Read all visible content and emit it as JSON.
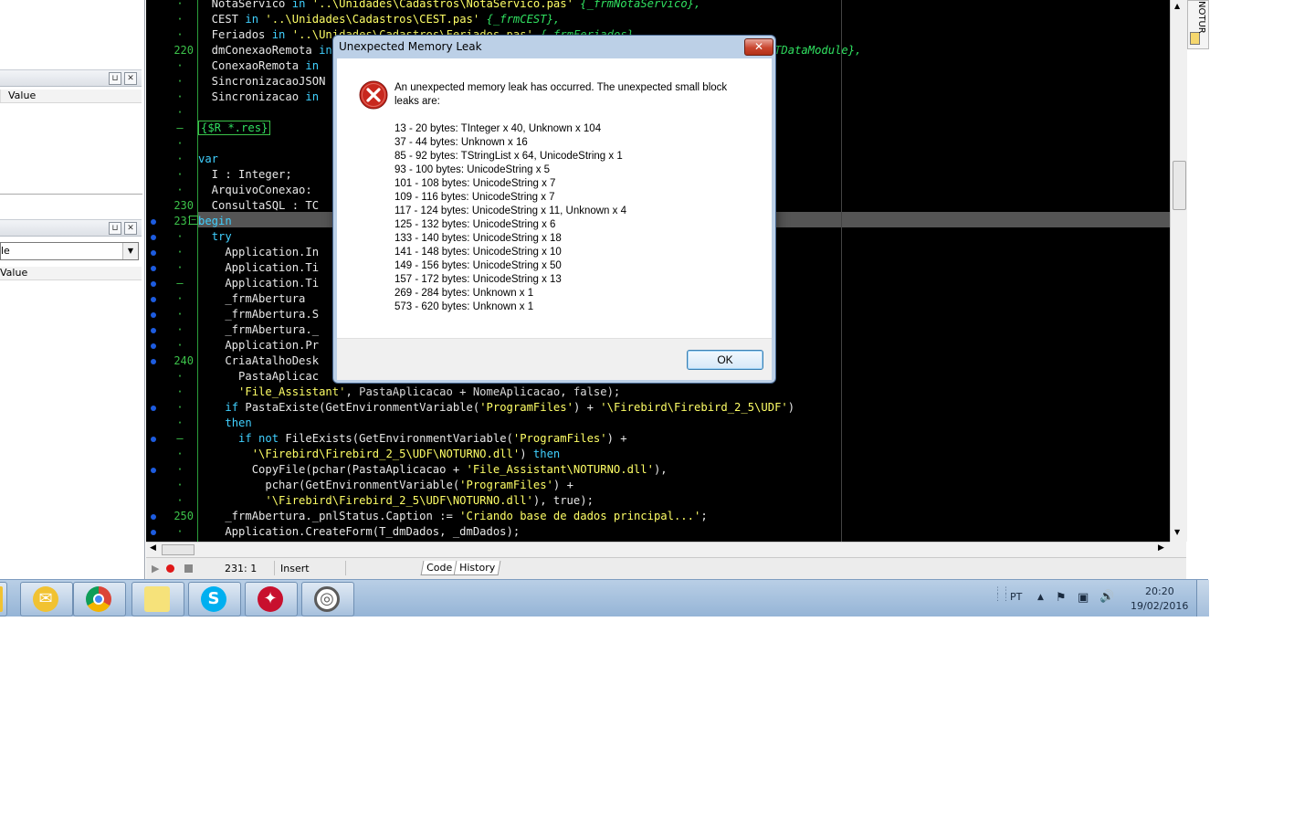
{
  "left_panel": {
    "panel1_header": "Value",
    "panel2_combo": "le",
    "panel2_header": "Value"
  },
  "editor": {
    "code_lines": [
      {
        "gutter": "·",
        "num": "",
        "bp": false,
        "html": "  NotaServico <span class=\"kw\">in</span> <span class=\"str\">'..\\Unidades\\Cadastros\\NotaServico.pas'</span> <span class=\"cmt\">{_frmNotaServico},</span>"
      },
      {
        "gutter": "·",
        "num": "",
        "bp": false,
        "html": "  CEST <span class=\"kw\">in</span> <span class=\"str\">'..\\Unidades\\Cadastros\\CEST.pas'</span> <span class=\"cmt\">{_frmCEST},</span>"
      },
      {
        "gutter": "·",
        "num": "",
        "bp": false,
        "html": "  Feriados <span class=\"kw\">in</span> <span class=\"str\">'..\\Unidades\\Cadastros\\Feriados.pas'</span> <span class=\"cmt\">{_frmFeriados},</span>"
      },
      {
        "gutter": "",
        "num": "220",
        "bp": false,
        "html": "  dmConexaoRemota <span class=\"kw\">in</span> <span class=\"str\">'..\\Unidades\\DataModules\\dmConexaoRemota.pas'</span> <span class=\"cmt\">{_dmConexaoRemota: TDataModule},</span>"
      },
      {
        "gutter": "·",
        "num": "",
        "bp": false,
        "html": "  ConexaoRemota <span class=\"kw\">in</span>"
      },
      {
        "gutter": "·",
        "num": "",
        "bp": false,
        "html": "  SincronizacaoJSON"
      },
      {
        "gutter": "·",
        "num": "",
        "bp": false,
        "html": "  Sincronizacao <span class=\"kw\">in</span>"
      },
      {
        "gutter": "·",
        "num": "",
        "bp": false,
        "html": ""
      },
      {
        "gutter": "–",
        "num": "",
        "bp": false,
        "html": "<span class=\"dir\" style=\"border:1px solid #3cc24a;padding:0 2px\">{$R *.res}</span>"
      },
      {
        "gutter": "·",
        "num": "",
        "bp": false,
        "html": ""
      },
      {
        "gutter": "·",
        "num": "",
        "bp": false,
        "html": "<span class=\"kw\">var</span>"
      },
      {
        "gutter": "·",
        "num": "",
        "bp": false,
        "html": "  I : Integer;"
      },
      {
        "gutter": "·",
        "num": "",
        "bp": false,
        "html": "  ArquivoConexao:"
      },
      {
        "gutter": "",
        "num": "230",
        "bp": false,
        "html": "  ConsultaSQL : TC"
      },
      {
        "gutter": "",
        "num": "231",
        "bp": true,
        "html": "<span class=\"kw\">begin</span>"
      },
      {
        "gutter": "·",
        "num": "",
        "bp": true,
        "html": "  <span class=\"kw\">try</span>"
      },
      {
        "gutter": "·",
        "num": "",
        "bp": true,
        "html": "    Application.In"
      },
      {
        "gutter": "·",
        "num": "",
        "bp": true,
        "html": "    Application.Ti"
      },
      {
        "gutter": "–",
        "num": "",
        "bp": true,
        "html": "    Application.Ti"
      },
      {
        "gutter": "·",
        "num": "",
        "bp": true,
        "html": "    _frmAbertura"
      },
      {
        "gutter": "·",
        "num": "",
        "bp": true,
        "html": "    _frmAbertura.S"
      },
      {
        "gutter": "·",
        "num": "",
        "bp": true,
        "html": "    _frmAbertura._                                                                   ;"
      },
      {
        "gutter": "·",
        "num": "",
        "bp": true,
        "html": "    Application.Pr"
      },
      {
        "gutter": "",
        "num": "240",
        "bp": true,
        "html": "    CriaAtalhoDesk"
      },
      {
        "gutter": "·",
        "num": "",
        "bp": false,
        "html": "      PastaAplicac"
      },
      {
        "gutter": "·",
        "num": "",
        "bp": false,
        "html": "      <span class=\"str\">'File_Assistant'</span>, PastaAplicacao + NomeAplicacao, false);"
      },
      {
        "gutter": "·",
        "num": "",
        "bp": true,
        "html": "    <span class=\"kw\">if</span> PastaExiste(GetEnvironmentVariable(<span class=\"str\">'ProgramFiles'</span>) + <span class=\"str\">'\\Firebird\\Firebird_2_5\\UDF'</span>)"
      },
      {
        "gutter": "·",
        "num": "",
        "bp": false,
        "html": "    <span class=\"kw\">then</span>"
      },
      {
        "gutter": "–",
        "num": "",
        "bp": true,
        "html": "      <span class=\"kw\">if not</span> FileExists(GetEnvironmentVariable(<span class=\"str\">'ProgramFiles'</span>) +"
      },
      {
        "gutter": "·",
        "num": "",
        "bp": false,
        "html": "        <span class=\"str\">'\\Firebird\\Firebird_2_5\\UDF\\NOTURNO.dll'</span>) <span class=\"kw\">then</span>"
      },
      {
        "gutter": "·",
        "num": "",
        "bp": true,
        "html": "        CopyFile(pchar(PastaAplicacao + <span class=\"str\">'File_Assistant\\NOTURNO.dll'</span>),"
      },
      {
        "gutter": "·",
        "num": "",
        "bp": false,
        "html": "          pchar(GetEnvironmentVariable(<span class=\"str\">'ProgramFiles'</span>) +"
      },
      {
        "gutter": "·",
        "num": "",
        "bp": false,
        "html": "          <span class=\"str\">'\\Firebird\\Firebird_2_5\\UDF\\NOTURNO.dll'</span>), true);"
      },
      {
        "gutter": "",
        "num": "250",
        "bp": true,
        "html": "    _frmAbertura._pnlStatus.Caption := <span class=\"str\">'Criando base de dados principal...'</span>;"
      },
      {
        "gutter": "·",
        "num": "",
        "bp": true,
        "html": "    Application.CreateForm(T_dmDados, _dmDados);"
      }
    ],
    "status": {
      "position": "231:  1",
      "mode": "Insert",
      "tab_code": "Code",
      "tab_history": "History"
    }
  },
  "right_strip": {
    "text": "NOTUR"
  },
  "taskbar": {
    "apps": [
      {
        "name": "outlook-app",
        "color": "#f1c232"
      },
      {
        "name": "chrome-app",
        "color": "#db4437"
      },
      {
        "name": "sticky-notes-app",
        "color": "#f6e27a"
      },
      {
        "name": "skype-app",
        "color": "#00aff0"
      },
      {
        "name": "delphi-app",
        "color": "#c8102e"
      },
      {
        "name": "target-app",
        "color": "#5a5a5a"
      }
    ],
    "tray": {
      "language": "PT",
      "time": "20:20",
      "date": "19/02/2016"
    }
  },
  "dialog": {
    "title": "Unexpected Memory Leak",
    "close_glyph": "✕",
    "message": "An unexpected memory leak has occurred. The unexpected small block leaks are:",
    "leaks": [
      "13 - 20 bytes: TInteger x 40, Unknown x 104",
      "37 - 44 bytes: Unknown x 16",
      "85 - 92 bytes: TStringList x 64, UnicodeString x 1",
      "93 - 100 bytes: UnicodeString x 5",
      "101 - 108 bytes: UnicodeString x 7",
      "109 - 116 bytes: UnicodeString x 7",
      "117 - 124 bytes: UnicodeString x 11, Unknown x 4",
      "125 - 132 bytes: UnicodeString x 6",
      "133 - 140 bytes: UnicodeString x 18",
      "141 - 148 bytes: UnicodeString x 10",
      "149 - 156 bytes: UnicodeString x 50",
      "157 - 172 bytes: UnicodeString x 13",
      "269 - 284 bytes: Unknown x 1",
      "573 - 620 bytes: Unknown x 1"
    ],
    "ok_label": "OK"
  }
}
